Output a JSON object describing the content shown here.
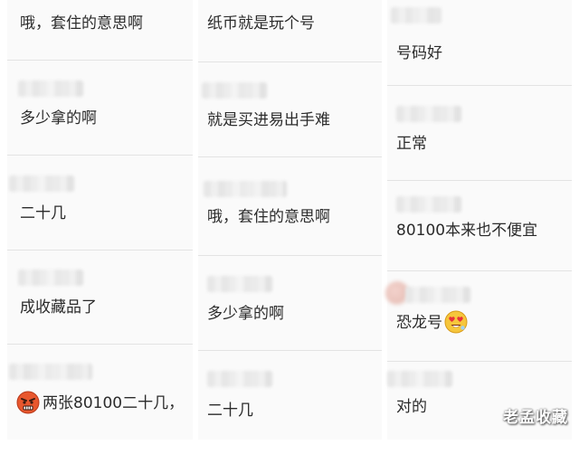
{
  "columns": [
    {
      "comments": [
        {
          "text": "哦，套住的意思啊"
        },
        {
          "text": "多少拿的啊"
        },
        {
          "text": "二十几"
        },
        {
          "text": "成收藏品了"
        },
        {
          "text": "两张80100二十几，",
          "icon": "angry-face-icon"
        }
      ]
    },
    {
      "comments": [
        {
          "text": "纸币就是玩个号"
        },
        {
          "text": "就是买进易出手难"
        },
        {
          "text": "哦，套住的意思啊"
        },
        {
          "text": "多少拿的啊"
        },
        {
          "text": "二十几"
        }
      ]
    },
    {
      "comments": [
        {
          "text": "号码好"
        },
        {
          "text": "正常"
        },
        {
          "text": "80100本来也不便宜"
        },
        {
          "text": "恐龙号",
          "icon": "heart-eyes-face-icon"
        },
        {
          "text": "对的"
        }
      ]
    }
  ],
  "watermark": "老孟收藏",
  "colors": {
    "background": "#ffffff",
    "panel": "#fafafa",
    "divider": "#e3e3e3",
    "text": "#2b2b2b"
  }
}
